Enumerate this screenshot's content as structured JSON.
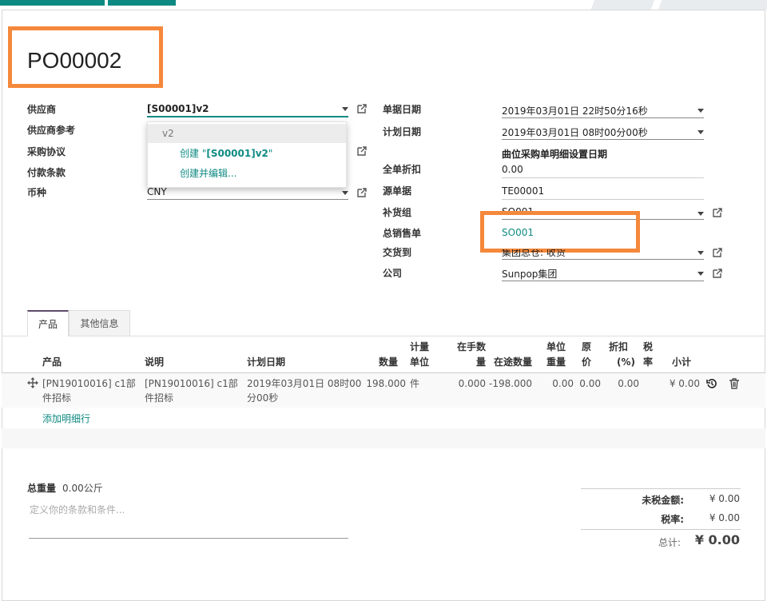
{
  "colors": {
    "accent": "#0f8a83",
    "highlight": "#f5883b",
    "tab_active_border": "#5d4a6b"
  },
  "title": "PO00002",
  "form_left": {
    "vendor_label": "供应商",
    "vendor_value": "[S00001]v2",
    "vendor_ref_label": "供应商参考",
    "agreement_label": "采购协议",
    "payment_terms_label": "付款条款",
    "currency_label": "币种",
    "currency_value": "CNY"
  },
  "vendor_dropdown": {
    "item_search": "v2",
    "create_prefix": "创建 \"",
    "create_name": "[S00001]v2",
    "create_suffix": "\"",
    "create_edit": "创建并编辑..."
  },
  "form_right": {
    "order_date_label": "单据日期",
    "order_date_value": "2019年03月01日 22时50分16秒",
    "planned_date_label": "计划日期",
    "planned_date_value": "2019年03月01日 08时00分00秒",
    "planned_date_note": "曲位采购单明细设置日期",
    "discount_label": "全单折扣",
    "discount_value": "0.00",
    "origin_label": "源单据",
    "origin_value": "TE00001",
    "group_label": "补货组",
    "group_value": "SO001",
    "sale_label": "总销售单",
    "sale_value": "SO001",
    "deliver_label": "交货到",
    "deliver_value": "集团总仓: 收货",
    "company_label": "公司",
    "company_value": "Sunpop集团"
  },
  "tabs": [
    "产品",
    "其他信息"
  ],
  "table": {
    "headers": {
      "product": "产品",
      "description": "说明",
      "planned": "计划日期",
      "qty": "数量",
      "uom_1": "计量",
      "uom_2": "单位",
      "onhand_1": "在手数",
      "onhand_2": "量",
      "transit": "在途数量",
      "unitweight_1": "单位",
      "unitweight_2": "重量",
      "price_1": "原",
      "price_2": "价",
      "disc_1": "折扣",
      "disc_2": "(%)",
      "tax_1": "税",
      "tax_2": "率",
      "subtotal": "小计"
    },
    "rows": [
      {
        "product_1": "[PN19010016] c1部",
        "product_2": "件招标",
        "desc_1": "[PN19010016] c1部",
        "desc_2": "件招标",
        "planned_1": "2019年03月01日 08时00",
        "planned_2": "分00秒",
        "qty": "198.000",
        "uom": "件",
        "onhand": "0.000",
        "transit": "-198.000",
        "unit_weight": "0.00",
        "price": "0.00",
        "discount": "0.00",
        "subtotal": "¥ 0.00"
      }
    ],
    "add_line": "添加明细行"
  },
  "footer": {
    "weight_label": "总重量",
    "weight_value": "0.00公斤",
    "terms_placeholder": "定义你的条款和条件...",
    "untaxed_label": "未税金额:",
    "untaxed_value": "¥ 0.00",
    "tax_label": "税率:",
    "tax_value": "¥ 0.00",
    "total_label": "总计:",
    "total_value": "¥ 0.00"
  }
}
